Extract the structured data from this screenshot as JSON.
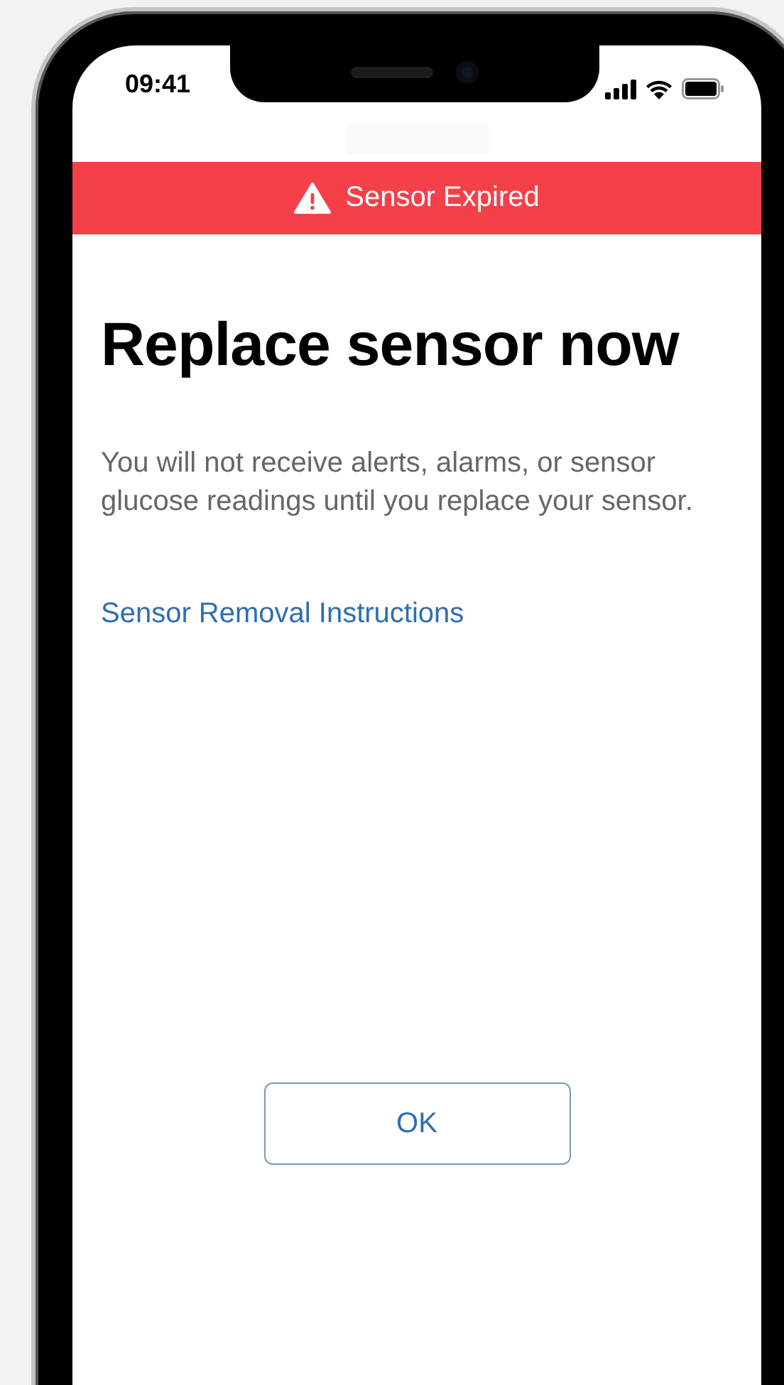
{
  "status_bar": {
    "time": "09:41"
  },
  "banner": {
    "text": "Sensor Expired"
  },
  "title": "Replace sensor now",
  "message": "You will not receive alerts, alarms, or sensor glucose readings until you replace your sensor.",
  "link": "Sensor Removal Instructions",
  "button": "OK"
}
